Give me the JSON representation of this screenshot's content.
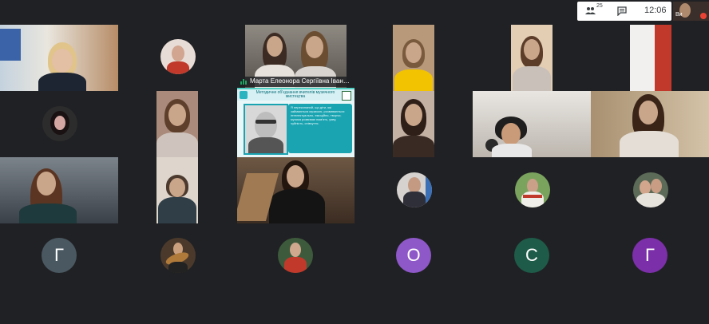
{
  "top_bar": {
    "participants_count": "25",
    "time": "12:06",
    "self_view_label": "Ви"
  },
  "presenter": {
    "name": "Марта Елеонора Сергіївна Іваненко"
  },
  "slide": {
    "title": "Методичне об'єднання вчителів музичного мистецтва",
    "body": "Я переконаний, що діти, які займаються музикою, розвиваються інтелектуально, емоційно, творчо; музика розвиває пам'ять, уяву, чуйність, співчуття."
  },
  "avatars": {
    "row4": [
      {
        "letter": "Г",
        "color": "#4a5861"
      },
      {
        "letter": "О",
        "color": "#8e58c8"
      },
      {
        "letter": "С",
        "color": "#1e5b48"
      },
      {
        "letter": "Г",
        "color": "#7b2fa8"
      }
    ]
  },
  "colors": {
    "background": "#202124",
    "tile": "#3c4043",
    "presenter_accent": "#4fd1c5",
    "speaking_indicator": "#1ea362"
  }
}
